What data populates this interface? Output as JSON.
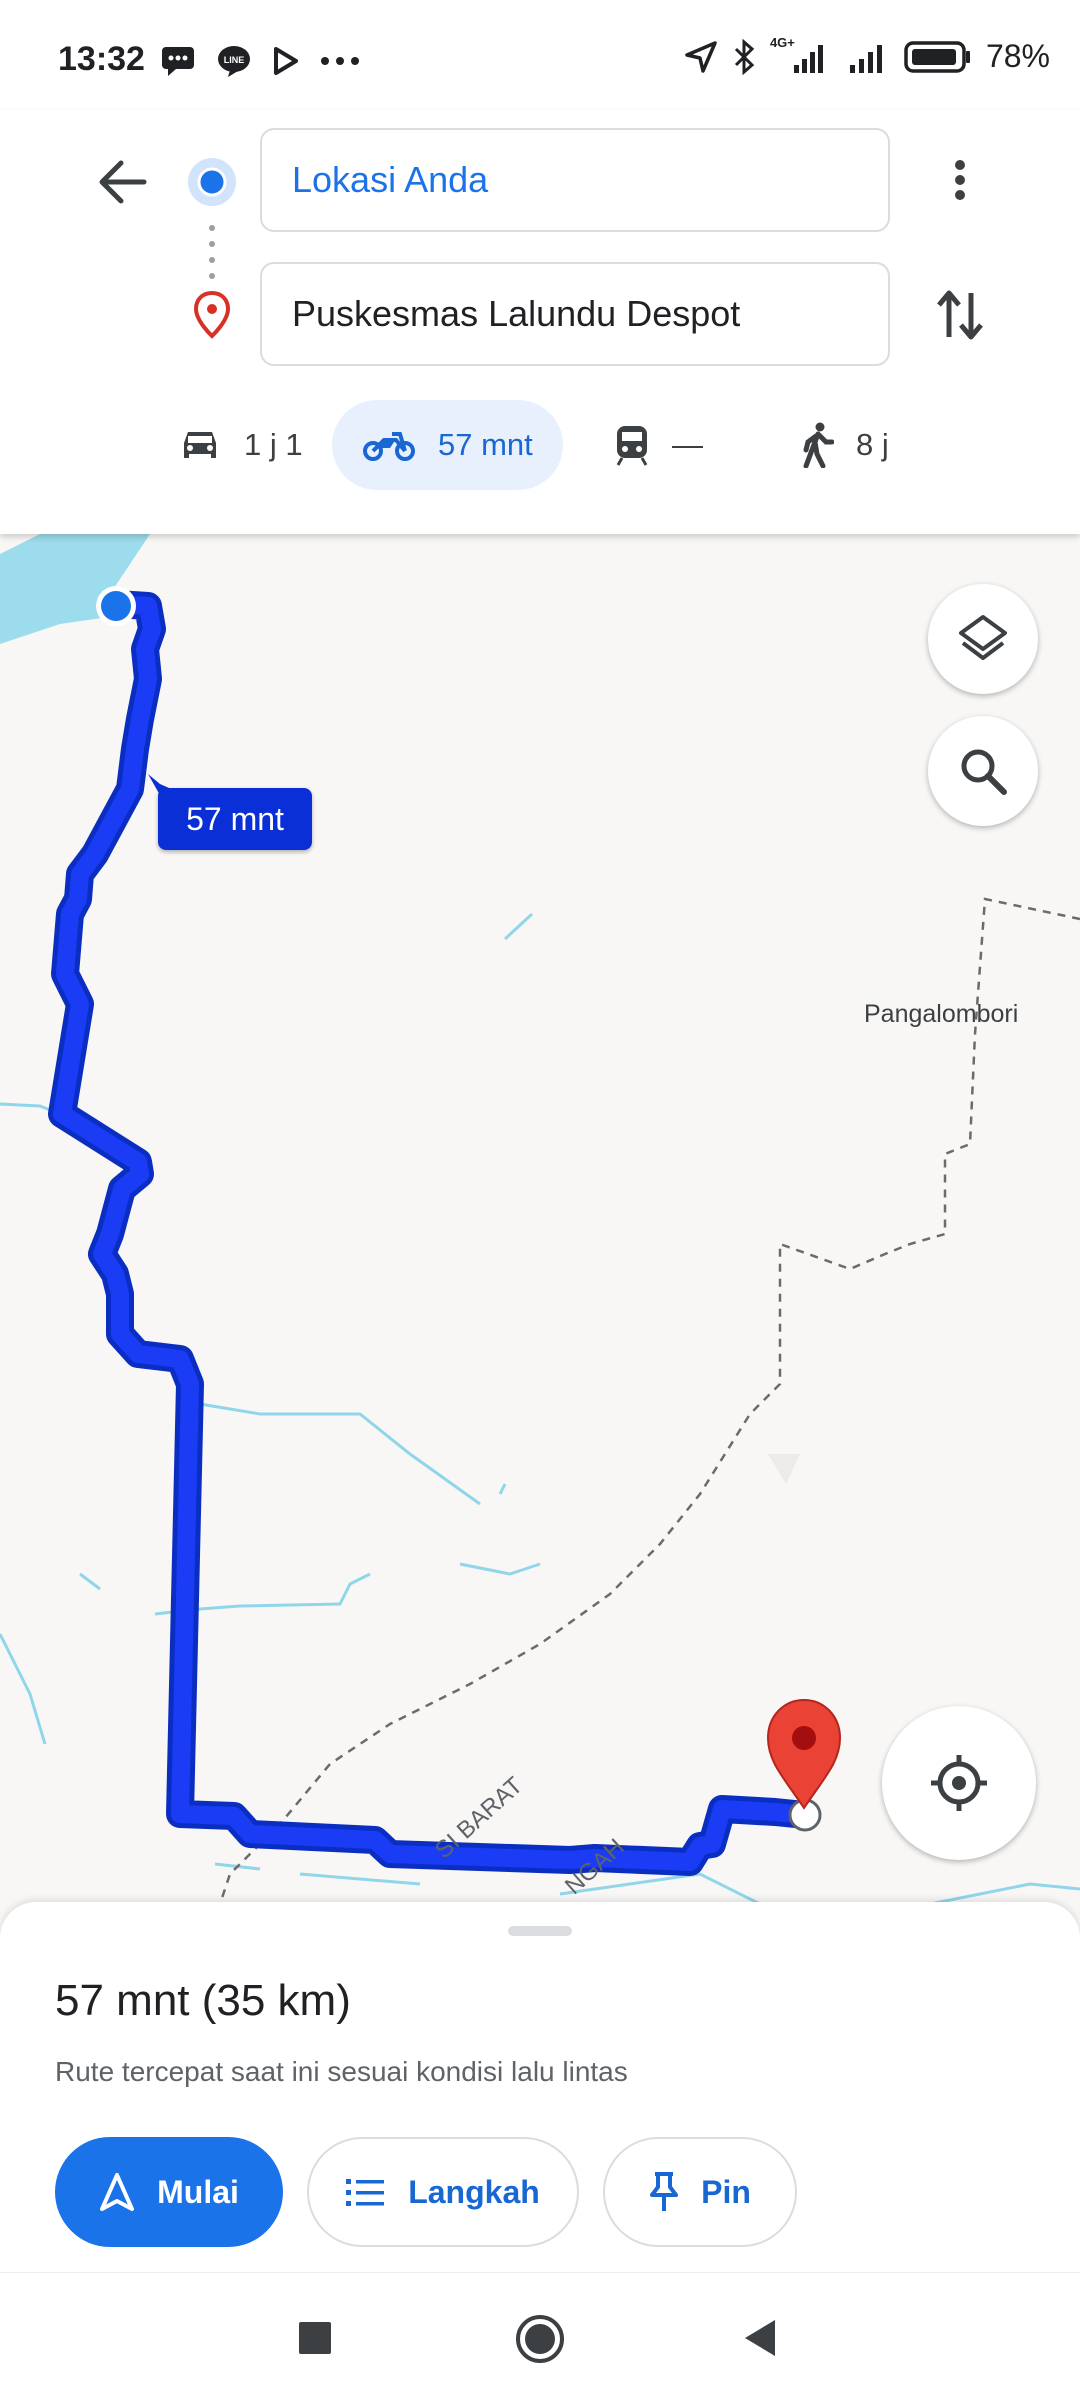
{
  "status_bar": {
    "time": "13:32",
    "network_label": "4G+",
    "battery": "78%",
    "battery_level": 0.78
  },
  "directions": {
    "origin": "Lokasi Anda",
    "destination": "Puskesmas Lalundu Despot",
    "modes": [
      {
        "name": "car",
        "label": "1 j 1",
        "selected": false
      },
      {
        "name": "motorcycle",
        "label": "57 mnt",
        "selected": true
      },
      {
        "name": "transit",
        "label": "—",
        "selected": false
      },
      {
        "name": "walk",
        "label": "8 j",
        "selected": false
      }
    ]
  },
  "map": {
    "route_label": "57 mnt",
    "place_label": "Pangalombori",
    "road_labels": [
      "SI BARAT",
      "NGAH"
    ],
    "route_color": "#1a3cf5",
    "destination_pin_color": "#ea4335"
  },
  "sheet": {
    "summary": "57 mnt (35 km)",
    "note": "Rute tercepat saat ini sesuai kondisi lalu lintas",
    "start_label": "Mulai",
    "steps_label": "Langkah",
    "pin_label": "Pin"
  },
  "colors": {
    "accent": "#1a73e8",
    "selected_mode_bg": "#e8f0fe",
    "route_label_bg": "#0a2fd6"
  }
}
